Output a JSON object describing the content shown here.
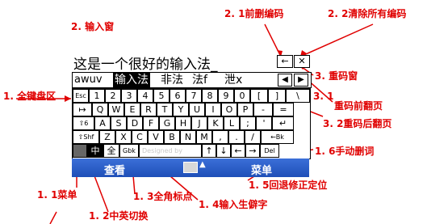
{
  "input_window": {
    "text": "这是一个很好的输入法_",
    "back_button": "←",
    "clear_button": "✕"
  },
  "candidates": {
    "code": "awuv",
    "items": [
      "输入法",
      "非法",
      "法f",
      "泄x"
    ],
    "prev_label": "◀",
    "next_label": "▶"
  },
  "keyboard": {
    "row1": [
      "Esc",
      "1",
      "2",
      "3",
      "4",
      "5",
      "6",
      "7",
      "8",
      "9",
      "0",
      "[",
      "]",
      "\\"
    ],
    "row2": [
      "↦",
      "Q",
      "W",
      "E",
      "R",
      "T",
      "Y",
      "U",
      "I",
      "O",
      "P",
      "-",
      "="
    ],
    "row3": [
      "⇧6",
      "A",
      "S",
      "D",
      "F",
      "G",
      "H",
      "J",
      "K",
      "L",
      ";",
      "'",
      "↵"
    ],
    "row4": [
      "⇧Shf",
      "Z",
      "X",
      "C",
      "V",
      "B",
      "N",
      "M",
      ",",
      ".",
      "/",
      "←Bk"
    ],
    "row5": [
      "▒",
      "中",
      "全",
      "Gbk",
      "Designed by",
      "↑",
      "↓",
      "←",
      "→",
      "Del"
    ]
  },
  "taskbar": {
    "left": "查看",
    "right": "菜单"
  },
  "annotations": {
    "input_window": "2. 输入窗",
    "delete_forward": "2. 1前删编码",
    "clear_all": "2. 2清除所有编码",
    "code_window": "3. 重码窗",
    "full_keyboard": "1. 全键盘区",
    "page_up": "3. 1",
    "page_up_text": "重码前翻页",
    "page_down": "3. 2重码后翻页",
    "manual_delete": "1. 6手动删词",
    "backspace": "1. 5回退修正定位",
    "menu": "1. 1菜单",
    "full_width": "1. 3全角标点",
    "cn_en": "1. 2中英切换",
    "rare_chars": "1. 4输入生僻字"
  },
  "colors": {
    "annotation": "#e00000",
    "taskbar": "#2a5cc8",
    "selected": "#000000"
  }
}
